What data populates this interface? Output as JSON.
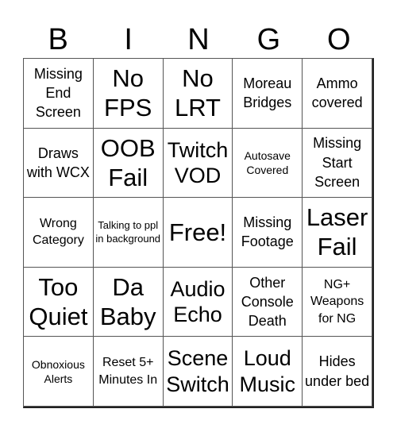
{
  "header": {
    "letters": [
      "B",
      "I",
      "N",
      "G",
      "O"
    ]
  },
  "cells": [
    {
      "label": "Missing End Screen",
      "size": "s-s"
    },
    {
      "label": "No FPS",
      "size": "s-xl"
    },
    {
      "label": "No LRT",
      "size": "s-xl"
    },
    {
      "label": "Moreau Bridges",
      "size": "s-s"
    },
    {
      "label": "Ammo covered",
      "size": "s-s"
    },
    {
      "label": "Draws with WCX",
      "size": "s-s"
    },
    {
      "label": "OOB Fail",
      "size": "s-xl"
    },
    {
      "label": "Twitch VOD",
      "size": "s-l"
    },
    {
      "label": "Autosave Covered",
      "size": "s-xxs"
    },
    {
      "label": "Missing Start Screen",
      "size": "s-s"
    },
    {
      "label": "Wrong Category",
      "size": "s-xs"
    },
    {
      "label": "Talking to ppl in background",
      "size": "s-tiny"
    },
    {
      "label": "Free!",
      "size": "s-xl"
    },
    {
      "label": "Missing Footage",
      "size": "s-s"
    },
    {
      "label": "Laser Fail",
      "size": "s-xl"
    },
    {
      "label": "Too Quiet",
      "size": "s-xl"
    },
    {
      "label": "Da Baby",
      "size": "s-xl"
    },
    {
      "label": "Audio Echo",
      "size": "s-l"
    },
    {
      "label": "Other Console Death",
      "size": "s-s"
    },
    {
      "label": "NG+ Weapons for NG",
      "size": "s-xs"
    },
    {
      "label": "Obnoxious Alerts",
      "size": "s-xxs"
    },
    {
      "label": "Reset 5+ Minutes In",
      "size": "s-xs"
    },
    {
      "label": "Scene Switch",
      "size": "s-l"
    },
    {
      "label": "Loud Music",
      "size": "s-l"
    },
    {
      "label": "Hides under bed",
      "size": "s-s"
    }
  ]
}
